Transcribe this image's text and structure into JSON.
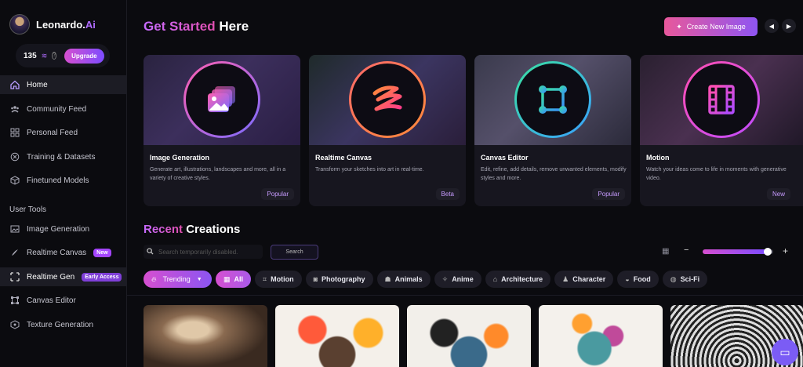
{
  "brand": {
    "name": "Leonardo.",
    "name_accent": "Ai"
  },
  "tokens": {
    "count": "135",
    "upgrade_label": "Upgrade"
  },
  "nav": [
    {
      "label": "Home",
      "icon": "home-icon"
    },
    {
      "label": "Community Feed",
      "icon": "community-icon"
    },
    {
      "label": "Personal Feed",
      "icon": "grid-icon"
    },
    {
      "label": "Training & Datasets",
      "icon": "training-icon"
    },
    {
      "label": "Finetuned Models",
      "icon": "cube-icon"
    }
  ],
  "user_tools_title": "User Tools",
  "tools": [
    {
      "label": "Image Generation",
      "icon": "image-icon",
      "badge": ""
    },
    {
      "label": "Realtime Canvas",
      "icon": "brush-icon",
      "badge": "New"
    },
    {
      "label": "Realtime Gen",
      "icon": "realtime-icon",
      "badge": "Early Access"
    },
    {
      "label": "Canvas Editor",
      "icon": "canvas-icon",
      "badge": ""
    },
    {
      "label": "Texture Generation",
      "icon": "texture-icon",
      "badge": ""
    }
  ],
  "header": {
    "title_accent": "Get Started",
    "title_rest": " Here",
    "create_label": "Create New Image"
  },
  "cards": [
    {
      "title": "Image Generation",
      "desc": "Generate art, illustrations, landscapes and more, all in a variety of creative styles.",
      "tag": "Popular"
    },
    {
      "title": "Realtime Canvas",
      "desc": "Transform your sketches into art in real-time.",
      "tag": "Beta"
    },
    {
      "title": "Canvas Editor",
      "desc": "Edit, refine, add details, remove unwanted elements, modify styles and more.",
      "tag": "Popular"
    },
    {
      "title": "Motion",
      "desc": "Watch your ideas come to life in moments with generative video.",
      "tag": "New"
    }
  ],
  "recent": {
    "title_accent": "Recent",
    "title_rest": " Creations",
    "search_placeholder": "Search temporarily disabled.",
    "search_label": "Search",
    "zoom_level": 0.95
  },
  "filters": {
    "trending": "Trending",
    "chips": [
      "All",
      "Motion",
      "Photography",
      "Animals",
      "Anime",
      "Architecture",
      "Character",
      "Food",
      "Sci-Fi"
    ]
  },
  "colors": {
    "accent": "#b06cff",
    "gradient_start": "#d64fd0",
    "gradient_end": "#7d4cff"
  }
}
